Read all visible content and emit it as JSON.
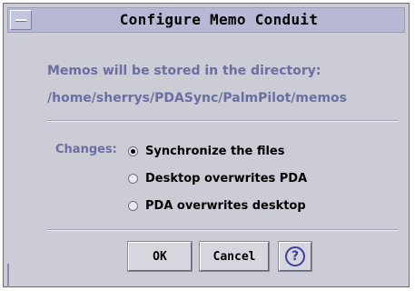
{
  "window": {
    "title": "Configure Memo Conduit"
  },
  "info": {
    "line1": "Memos will be stored in the directory:",
    "path": "/home/sherrys/PDASync/PalmPilot/memos"
  },
  "changes": {
    "label": "Changes:",
    "options": [
      {
        "label": "Synchronize the files",
        "selected": true
      },
      {
        "label": "Desktop overwrites PDA",
        "selected": false
      },
      {
        "label": "PDA overwrites desktop",
        "selected": false
      }
    ]
  },
  "buttons": {
    "ok": "OK",
    "cancel": "Cancel",
    "help_glyph": "?"
  },
  "icons": {
    "window_menu": "window-menu-icon",
    "help": "help-icon"
  }
}
